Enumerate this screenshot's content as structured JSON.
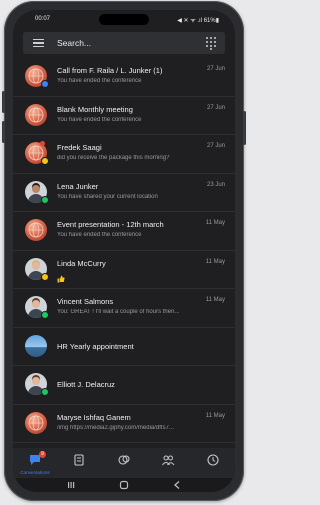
{
  "status_bar": {
    "time": "00:07",
    "right": "◀ ✕ ᯤ .ıl 61%▮"
  },
  "search": {
    "label": "Search..."
  },
  "conversations": [
    {
      "title": "Call from F. Raila / L. Junker (1)",
      "date": "27 Jun",
      "preview": "You have ended the conference",
      "avatar": "globe",
      "badge": "#3b82f6",
      "red_dot": false
    },
    {
      "title": "Blank Monthly meeting",
      "date": "27 Jun",
      "preview": "You have ended the conference",
      "avatar": "globe",
      "badge": "",
      "red_dot": false
    },
    {
      "title": "Fredek Saagi",
      "date": "27 Jun",
      "preview": "did you receive the package this morning?",
      "avatar": "globe",
      "badge": "#f5c518",
      "red_dot": true
    },
    {
      "title": "Lena Junker",
      "date": "23 Jun",
      "preview": "You have shared your current location",
      "avatar": "person-dark",
      "badge": "#22c55e",
      "red_dot": false
    },
    {
      "title": "Event presentation - 12th march",
      "date": "11 May",
      "preview": "You have ended the conference",
      "avatar": "globe",
      "badge": "",
      "red_dot": false
    },
    {
      "title": "Linda McCurry",
      "date": "11 May",
      "preview": "",
      "avatar": "person-blonde",
      "badge": "#f5c518",
      "red_dot": false
    },
    {
      "title": "Vincent Salmons",
      "date": "11 May",
      "preview": "You: GREAT ! I'll wait a couple of hours then...",
      "avatar": "person-light",
      "badge": "#22c55e",
      "red_dot": false
    },
    {
      "title": "HR Yearly appointment",
      "date": "",
      "preview": "",
      "avatar": "landscape",
      "badge": "",
      "red_dot": false
    },
    {
      "title": "Elliott J. Delacruz",
      "date": "",
      "preview": "",
      "avatar": "person-light",
      "badge": "#22c55e",
      "red_dot": false
    },
    {
      "title": "Maryse Ishfaq Ganem",
      "date": "11 May",
      "preview": "/img https://media2.giphy.com/media/dfts7...",
      "avatar": "globe",
      "badge": "",
      "red_dot": false
    }
  ],
  "tabs": [
    {
      "name": "conversations",
      "label": "Conversations",
      "badge": "9",
      "active": true
    },
    {
      "name": "notes",
      "label": "",
      "badge": "",
      "active": false
    },
    {
      "name": "calls",
      "label": "",
      "badge": "",
      "active": false
    },
    {
      "name": "contacts",
      "label": "",
      "badge": "",
      "active": false
    },
    {
      "name": "history",
      "label": "",
      "badge": "",
      "active": false
    }
  ],
  "colors": {
    "accent": "#3c83f0",
    "background": "#1f1f22",
    "unread": "#e0443a"
  }
}
